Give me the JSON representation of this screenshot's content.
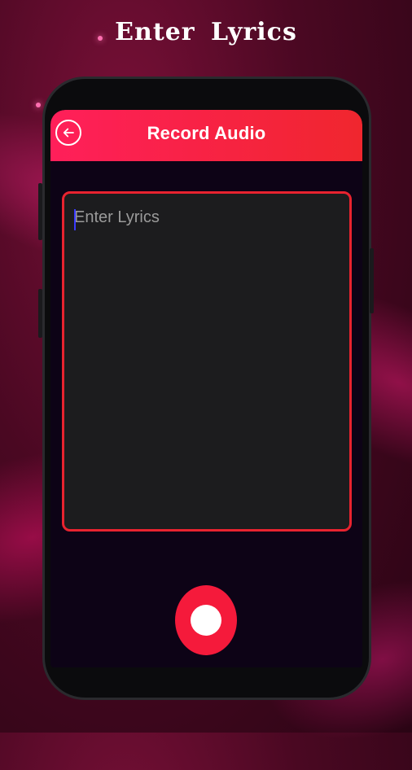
{
  "promo": {
    "title": "Enter  Lyrics"
  },
  "app_bar": {
    "title": "Record Audio",
    "back_icon": "back-arrow-icon"
  },
  "lyrics": {
    "placeholder": "Enter Lyrics",
    "value": ""
  },
  "record": {
    "icon": "record-icon"
  },
  "colors": {
    "accent": "#f51a3b",
    "header_start": "#ff1f5a",
    "header_end": "#f0262e",
    "border": "#e8232f",
    "background": "#0d0316"
  }
}
